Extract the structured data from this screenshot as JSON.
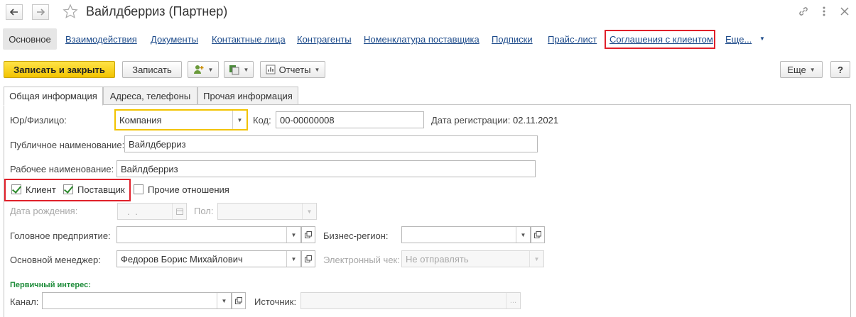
{
  "window": {
    "title": "Вайлдберриз (Партнер)",
    "icons": {
      "back": "arrow-left-icon",
      "forward": "arrow-right-icon",
      "favorite": "star-icon",
      "link": "link-icon",
      "menu": "more-vertical-icon",
      "close": "close-icon"
    }
  },
  "nav": {
    "active": "Основное",
    "links": [
      "Взаимодействия",
      "Документы",
      "Контактные лица",
      "Контрагенты",
      "Номенклатура поставщика",
      "Подписки",
      "Прайс-лист",
      "Соглашения с клиентом",
      "Еще..."
    ],
    "highlight_color": "#e0202a"
  },
  "toolbar": {
    "save_close": "Записать и закрыть",
    "save": "Записать",
    "reports": "Отчеты",
    "more": "Еще",
    "help": "?",
    "accent_color": "#f2c300"
  },
  "tabs": [
    "Общая информация",
    "Адреса, телефоны",
    "Прочая информация"
  ],
  "form": {
    "entity_type": {
      "label": "Юр/Физлицо:",
      "value": "Компания"
    },
    "code": {
      "label": "Код:",
      "value": "00-00000008"
    },
    "reg_date": {
      "label": "Дата регистрации:",
      "value": "02.11.2021"
    },
    "public_name": {
      "label": "Публичное наименование:",
      "value": "Вайлдберриз"
    },
    "work_name": {
      "label": "Рабочее наименование:",
      "value": "Вайлдберриз"
    },
    "checkboxes": {
      "client": {
        "label": "Клиент",
        "checked": true
      },
      "supplier": {
        "label": "Поставщик",
        "checked": true
      },
      "other": {
        "label": "Прочие отношения",
        "checked": false
      }
    },
    "birth_date": {
      "label": "Дата рождения:",
      "value": " .  ."
    },
    "gender": {
      "label": "Пол:",
      "value": ""
    },
    "parent_company": {
      "label": "Головное предприятие:",
      "value": ""
    },
    "business_region": {
      "label": "Бизнес-регион:",
      "value": ""
    },
    "manager": {
      "label": "Основной менеджер:",
      "value": "Федоров Борис Михайлович"
    },
    "e_receipt": {
      "label": "Электронный чек:",
      "value": "Не отправлять"
    },
    "primary_interest": {
      "title": "Первичный интерес:"
    },
    "channel": {
      "label": "Канал:",
      "value": ""
    },
    "source": {
      "label": "Источник:",
      "value": "",
      "button": "..."
    }
  }
}
